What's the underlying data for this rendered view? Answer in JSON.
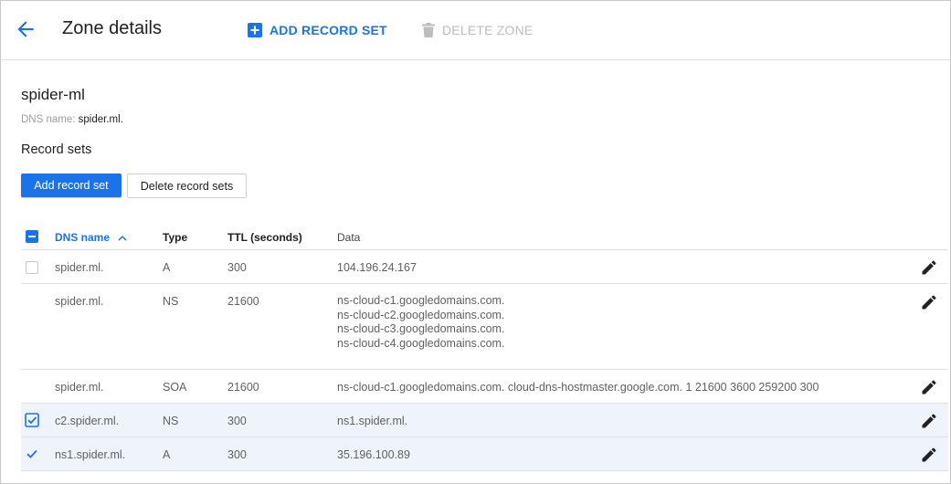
{
  "header": {
    "title": "Zone details",
    "add_record_set": "ADD RECORD SET",
    "delete_zone": "DELETE ZONE"
  },
  "zone": {
    "name": "spider-ml",
    "dns_label": "DNS name:",
    "dns_value": "spider.ml."
  },
  "record_sets": {
    "title": "Record sets",
    "add_button": "Add record set",
    "delete_button": "Delete record sets"
  },
  "table": {
    "columns": [
      "DNS name",
      "Type",
      "TTL (seconds)",
      "Data"
    ],
    "rows": [
      {
        "name": "spider.ml.",
        "type": "A",
        "ttl": "300",
        "data": [
          "104.196.24.167"
        ],
        "checkbox": "unchecked"
      },
      {
        "name": "spider.ml.",
        "type": "NS",
        "ttl": "21600",
        "data": [
          "ns-cloud-c1.googledomains.com.",
          "ns-cloud-c2.googledomains.com.",
          "ns-cloud-c3.googledomains.com.",
          "ns-cloud-c4.googledomains.com."
        ],
        "checkbox": "none"
      },
      {
        "name": "spider.ml.",
        "type": "SOA",
        "ttl": "21600",
        "data": [
          "ns-cloud-c1.googledomains.com. cloud-dns-hostmaster.google.com. 1 21600 3600 259200 300"
        ],
        "checkbox": "none"
      },
      {
        "name": "c2.spider.ml.",
        "type": "NS",
        "ttl": "300",
        "data": [
          "ns1.spider.ml."
        ],
        "checkbox": "checked"
      },
      {
        "name": "ns1.spider.ml.",
        "type": "A",
        "ttl": "300",
        "data": [
          "35.196.100.89"
        ],
        "checkbox": "checked"
      }
    ]
  },
  "colors": {
    "accent": "#1a73e8",
    "selected_row": "#eef3fc",
    "disabled": "#bdbdbd"
  },
  "icons": {
    "back": "arrow-left-icon",
    "add": "plus-box-icon",
    "delete": "trash-icon",
    "sort": "chevron-up-icon",
    "edit": "pencil-icon"
  }
}
